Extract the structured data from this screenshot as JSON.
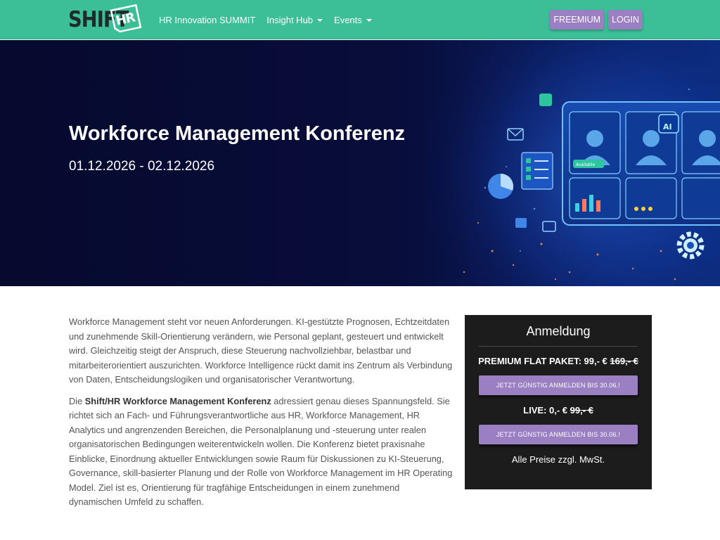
{
  "brand": {
    "logo_primary": "SHIFT",
    "logo_secondary": "HR"
  },
  "nav": {
    "links": [
      {
        "label": "HR Innovation SUMMIT",
        "dropdown": false
      },
      {
        "label": "Insight Hub",
        "dropdown": true
      },
      {
        "label": "Events",
        "dropdown": true
      }
    ],
    "buttons": {
      "freemium": "FREEMIUM",
      "login": "LOGIN"
    }
  },
  "hero": {
    "title": "Workforce Management Konferenz",
    "date": "01.12.2026 - 02.12.2026",
    "art_labels": {
      "ai": "AI",
      "available": "Available"
    }
  },
  "content": {
    "p1": "Workforce Management steht vor neuen Anforderungen. KI-gestützte Prognosen, Echtzeitdaten und zunehmende Skill-Orientierung verändern, wie Personal geplant, gesteuert und entwickelt wird. Gleichzeitig steigt der Anspruch, diese Steuerung nachvollziehbar, belastbar und mitarbeiterorientiert auszurichten. Workforce Intelligence rückt damit ins Zentrum als Verbindung von Daten, Entscheidungslogiken und organisatorischer Verantwortung.",
    "p2_pre": "Die ",
    "p2_bold": "Shift/HR Workforce Management Konferenz",
    "p2_post": " adressiert genau dieses Spannungsfeld. Sie richtet sich an Fach- und Führungsverantwortliche aus HR, Workforce Management, HR Analytics und angrenzenden Bereichen, die Personalplanung und -steuerung unter realen organisatorischen Bedingungen weiterentwickeln wollen. Die Konferenz bietet praxisnahe Einblicke, Einordnung aktueller Entwicklungen sowie Raum für Diskussionen zu KI-Steuerung, Governance, skill-basierter Planung und der Rolle von Workforce Management im HR Operating Model. Ziel ist es, Orientierung für tragfähige Entscheidungen in einem zunehmend dynamischen Umfeld zu schaffen."
  },
  "registration": {
    "title": "Anmeldung",
    "premium_label": "PREMIUM FLAT PAKET: 99,- € ",
    "premium_old": "169,- €",
    "premium_button": "JETZT GÜNSTIG ANMELDEN BIS 30.06.!",
    "live_label": "LIVE: 0,- € ",
    "live_old": "99,- €",
    "live_button": "JETZT GÜNSTIG ANMELDEN BIS 30.06.!",
    "note": "Alle Preise zzgl. MwSt."
  },
  "colors": {
    "navbar": "#3cbf97",
    "accent_button": "#9a7fc3",
    "hero_bg": "#060a2e",
    "card_bg": "#1c1c1c"
  }
}
